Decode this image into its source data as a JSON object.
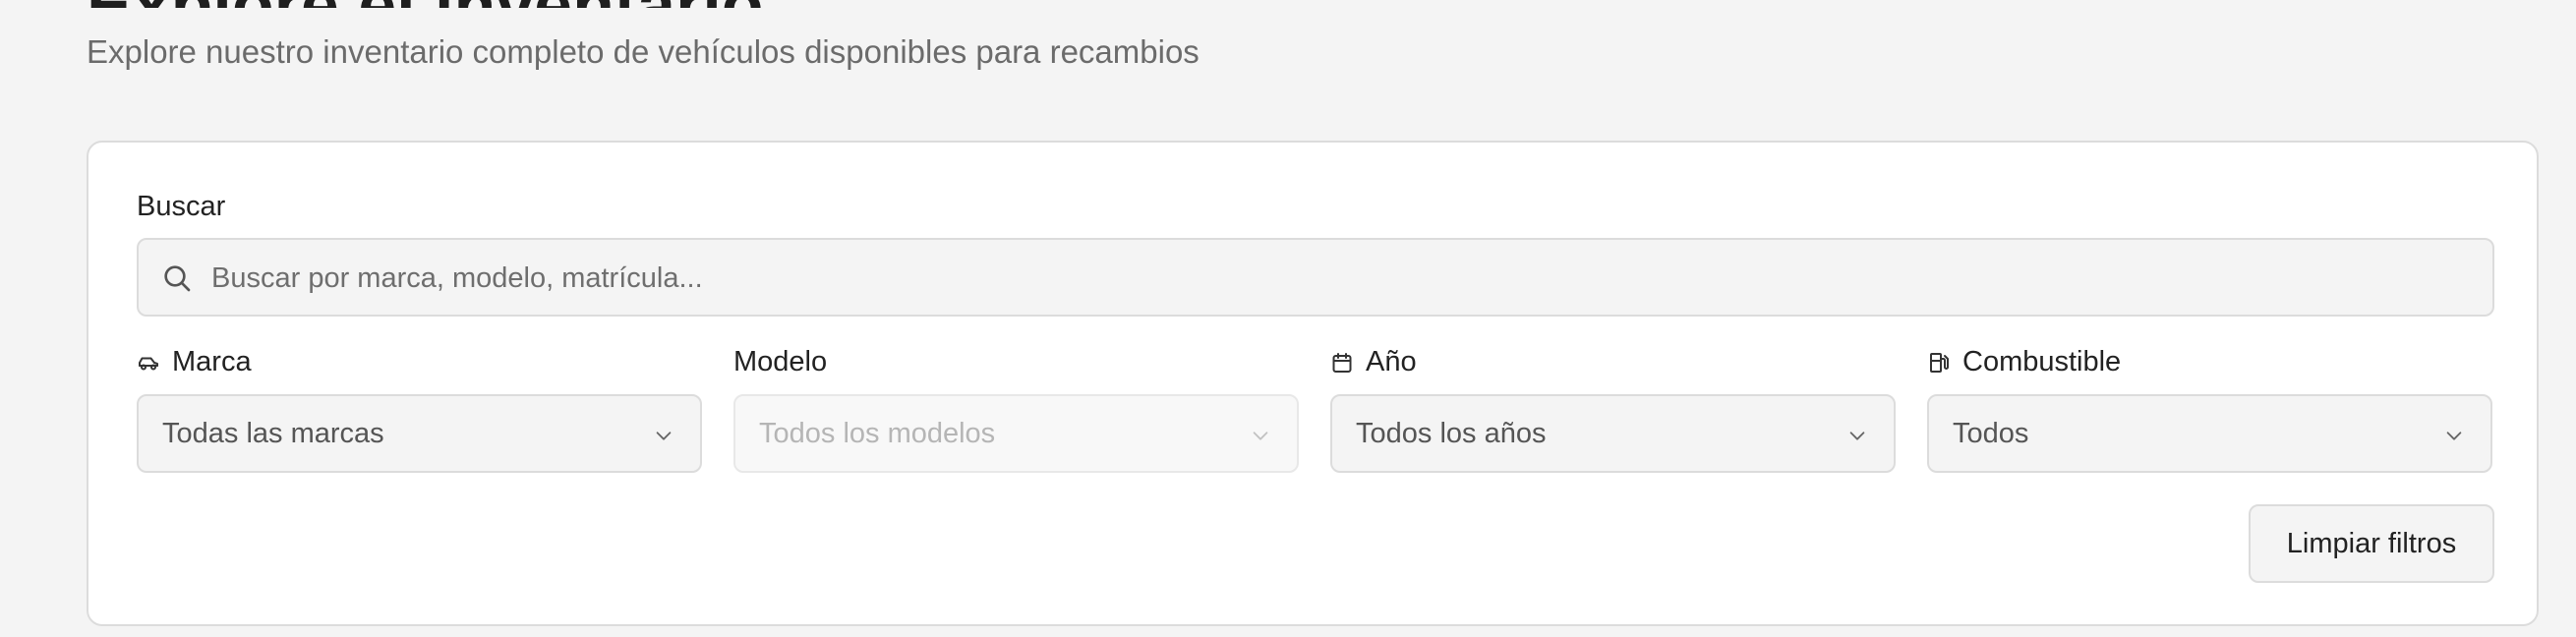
{
  "header": {
    "title": "Explore el inventario",
    "subtitle": "Explore nuestro inventario completo de vehículos disponibles para recambios"
  },
  "filters": {
    "search": {
      "label": "Buscar",
      "placeholder": "Buscar por marca, modelo, matrícula...",
      "value": ""
    },
    "marca": {
      "label": "Marca",
      "icon": "car-icon",
      "selected": "Todas las marcas"
    },
    "modelo": {
      "label": "Modelo",
      "selected": "Todos los modelos",
      "disabled": true
    },
    "anio": {
      "label": "Año",
      "icon": "calendar-icon",
      "selected": "Todos los años"
    },
    "combustible": {
      "label": "Combustible",
      "icon": "fuel-pump-icon",
      "selected": "Todos"
    },
    "clear_label": "Limpiar filtros"
  },
  "colors": {
    "background": "#f4f4f4",
    "card": "#ffffff",
    "border": "#dcdcdc",
    "text": "#222222",
    "muted": "#6b6b6b",
    "disabled_text": "#b5b5b5"
  }
}
